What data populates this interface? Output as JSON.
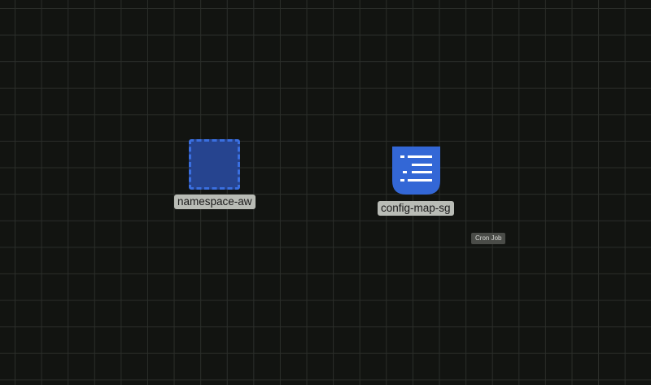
{
  "canvas": {
    "background": "#121411",
    "grid_color": "#2b2e2a"
  },
  "nodes": {
    "namespace": {
      "label": "namespace-aw",
      "fill": "#26448f",
      "border": "#3a6fe0",
      "icon": "namespace-dashed-box-icon"
    },
    "config_map": {
      "label": "config-map-sg",
      "fill": "#3367d6",
      "icon": "config-map-icon"
    }
  },
  "tags": {
    "cron_job": "Cron Job"
  }
}
